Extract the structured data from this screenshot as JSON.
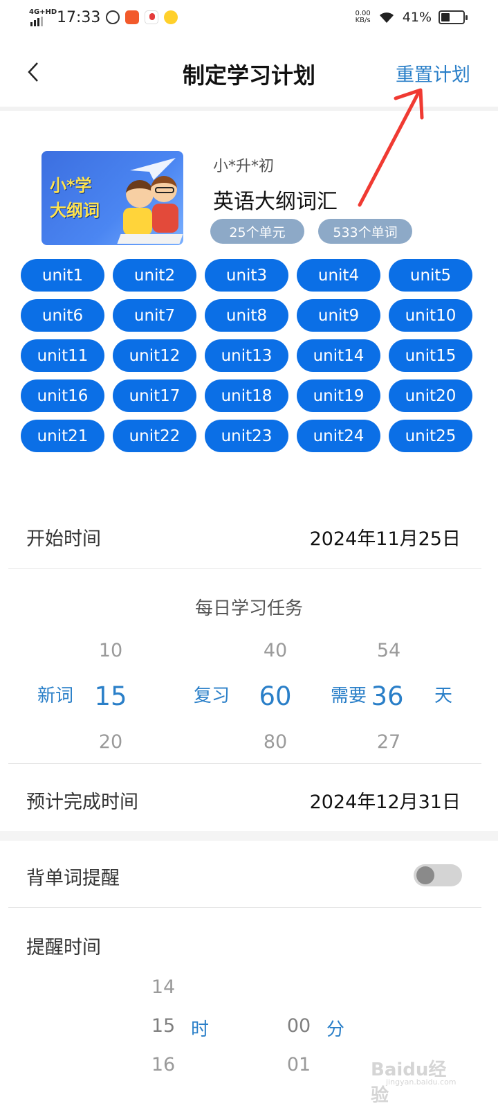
{
  "status_bar": {
    "network": "4G+HD",
    "time": "17:33",
    "net_speed_value": "0.00",
    "net_speed_unit": "KB/s",
    "battery": "41%",
    "battery_level_percent": 41
  },
  "header": {
    "title": "制定学习计划",
    "reset_label": "重置计划"
  },
  "book": {
    "cover_line1": "小*学",
    "cover_line2": "大纲词",
    "subtitle": "小*升*初",
    "title": "英语大纲词汇",
    "units_badge": "25个单元",
    "words_badge": "533个单词"
  },
  "units": [
    "unit1",
    "unit2",
    "unit3",
    "unit4",
    "unit5",
    "unit6",
    "unit7",
    "unit8",
    "unit9",
    "unit10",
    "unit11",
    "unit12",
    "unit13",
    "unit14",
    "unit15",
    "unit16",
    "unit17",
    "unit18",
    "unit19",
    "unit20",
    "unit21",
    "unit22",
    "unit23",
    "unit24",
    "unit25"
  ],
  "start": {
    "label": "开始时间",
    "value": "2024年11月25日"
  },
  "daily_task": {
    "title": "每日学习任务",
    "new_words": {
      "label": "新词",
      "above": "10",
      "selected": "15",
      "below": "20"
    },
    "review": {
      "label": "复习",
      "above": "40",
      "selected": "60",
      "below": "80"
    },
    "days": {
      "label": "需要",
      "unit": "天",
      "above": "54",
      "selected": "36",
      "below": "27"
    }
  },
  "finish": {
    "label": "预计完成时间",
    "value": "2024年12月31日"
  },
  "reminder": {
    "label": "背单词提醒",
    "enabled": false
  },
  "reminder_time": {
    "label": "提醒时间",
    "hour": {
      "above": "14",
      "selected": "15",
      "below": "16",
      "unit": "时"
    },
    "minute": {
      "selected": "00",
      "below": "01",
      "unit": "分"
    }
  },
  "watermark": {
    "text": "Baidu经验",
    "sub": "jingyan.baidu.com"
  }
}
